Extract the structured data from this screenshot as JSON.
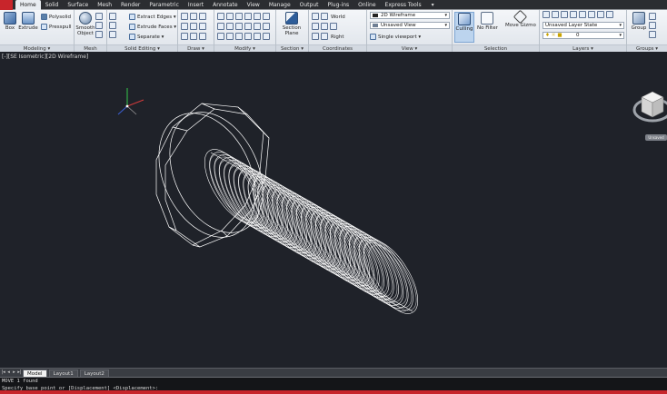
{
  "ribbon_tabs": [
    "Home",
    "Solid",
    "Surface",
    "Mesh",
    "Render",
    "Parametric",
    "Insert",
    "Annotate",
    "View",
    "Manage",
    "Output",
    "Plug-ins",
    "Online",
    "Express Tools"
  ],
  "tab_extra": "▾",
  "modeling": {
    "title": "Modeling ▾",
    "box_label": "Box",
    "extrude_label": "Extrude",
    "polysolid_label": "Polysolid",
    "presspull_label": "Presspull"
  },
  "mesh": {
    "title": "Mesh",
    "smooth_label": "Smooth",
    "object_label": "Object"
  },
  "solid_editing": {
    "title": "Solid Editing ▾",
    "extract_edges_label": "Extract Edges ▾",
    "extrude_faces_label": "Extrude Faces ▾",
    "separate_label": "Separate ▾"
  },
  "draw": {
    "title": "Draw ▾"
  },
  "modify": {
    "title": "Modify ▾"
  },
  "section": {
    "title": "Section ▾",
    "section_label": "Section",
    "plane_label": "Plane"
  },
  "coordinates": {
    "title": "Coordinates",
    "world_label": "World",
    "right_label": "Right"
  },
  "view": {
    "title": "View ▾",
    "visual_style": "2D Wireframe",
    "named_view": "Unsaved View",
    "viewport_config": "Single viewport ▾"
  },
  "selection": {
    "title": "Selection",
    "culling_label": "Culling",
    "nofilter_label": "No Filter",
    "gizmo_label": "Move Gizmo"
  },
  "layers": {
    "title": "Layers ▾",
    "layer_state": "Unsaved Layer State",
    "current_layer": "0"
  },
  "groups": {
    "title": "Groups ▾",
    "group_label": "Group"
  },
  "viewport": {
    "label": "[-][SE Isometric][2D Wireframe]",
    "viewcube_chip": "Unsaved"
  },
  "layout_tabs": {
    "nav": [
      "|◂",
      "◂",
      "▸",
      "▸|"
    ],
    "tabs": [
      "Model",
      "Layout1",
      "Layout2"
    ],
    "active": "Model"
  },
  "command": {
    "history": "MOVE 1 found",
    "prompt": "Specify base point or [Displacement] <Displacement>:"
  },
  "colors": {
    "viewport_bg": "#1f2229",
    "accent_red": "#c8252b",
    "wireframe": "#ffffff"
  }
}
